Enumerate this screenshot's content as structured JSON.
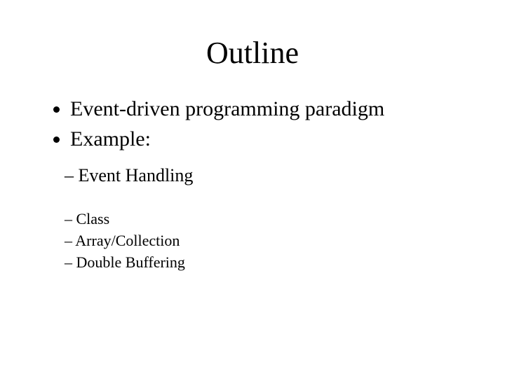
{
  "title": "Outline",
  "bullets": {
    "b1": "Event-driven programming paradigm",
    "b2": "Example:"
  },
  "sub_a": {
    "s1": "Event Handling"
  },
  "sub_b": {
    "s1": "Class",
    "s2": "Array/Collection",
    "s3": "Double Buffering"
  }
}
